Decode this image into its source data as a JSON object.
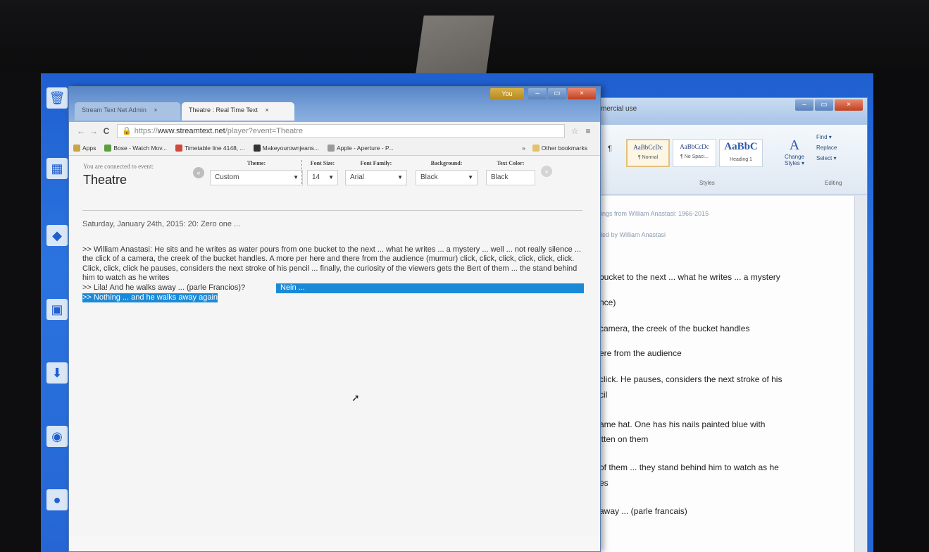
{
  "chrome": {
    "tabs": [
      {
        "label": "Stream Text Net Admin",
        "close": "×"
      },
      {
        "label": "Theatre : Real Time Text",
        "close": "×"
      }
    ],
    "user_button": "You",
    "window_controls": [
      "–",
      "▭",
      "×"
    ],
    "nav": {
      "back": "←",
      "forward": "→",
      "reload": "C"
    },
    "url": {
      "scheme": "https://",
      "host": "www.streamtext.net",
      "path": "/player?event=Theatre"
    },
    "star": "☆",
    "menu": "≡",
    "bookmarks": [
      {
        "label": "Apps",
        "color": "#c9a44b"
      },
      {
        "label": "Bose - Watch Mov...",
        "color": "#5aa03c"
      },
      {
        "label": "Timetable line 4148, ...",
        "color": "#d0483a"
      },
      {
        "label": "Makeyourownjeans...",
        "color": "#333333"
      },
      {
        "label": "Apple - Aperture - P...",
        "color": "#9a9a9a"
      }
    ],
    "bookmarks_overflow": "»",
    "other_bookmarks": "Other bookmarks"
  },
  "player": {
    "connected_label": "You are connected to event:",
    "event_name": "Theatre",
    "theme": {
      "label": "Theme:",
      "value": "Custom"
    },
    "font_size": {
      "label": "Font Size:",
      "value": "14"
    },
    "font_family": {
      "label": "Font Family:",
      "value": "Arial"
    },
    "background": {
      "label": "Background:",
      "value": "Black"
    },
    "text_color": {
      "label": "Text Color:",
      "value": "Black"
    },
    "transcript": {
      "date_line": "Saturday, January 24th, 2015: 20: Zero one ...",
      "paragraph": ">> William Anastasi: He sits and he writes as water pours from one bucket to the next ... what he writes ... a mystery ... well ... not really silence ... the click of a camera, the creek of the bucket handles. A more per here and there from the audience (murmur) click, click, click, click, click, click. Click, click, click he pauses, considers the next stroke of his pencil ... finally, the curiosity of the viewers gets the Bert of them ... the stand behind him to watch as he writes",
      "line_lila": ">> Lila! And he walks away ... (parle Francios)?",
      "line_nein": "Nein ...",
      "line_nothing": ">> Nothing ... and he walks away again"
    }
  },
  "word": {
    "title": "mercial use",
    "window_controls": [
      "–",
      "▭",
      "×"
    ],
    "styles": [
      {
        "sample": "AaBbCcDc",
        "name": "¶ Normal"
      },
      {
        "sample": "AaBbCcDc",
        "name": "¶ No Spaci..."
      },
      {
        "sample": "AaBbC",
        "name": "Heading 1"
      }
    ],
    "change_styles": {
      "big": "A",
      "label": "Change Styles ▾"
    },
    "editing": [
      "Find ▾",
      "Replace",
      "Select ▾"
    ],
    "group_styles": "Styles",
    "group_editing": "Editing",
    "doc_header": "ings from William Anastasi: 1966-2015",
    "doc_subheader": "led by William Anastasi",
    "lines": [
      "bucket to the next ... what he writes ... a mystery",
      "nce)",
      "camera, the creek of the bucket handles",
      "ere from the audience",
      "click. He pauses, considers the next stroke of his",
      "cil",
      "ame hat. One has his nails painted blue with",
      "itten on them",
      "of them ... they stand behind him to watch as he",
      "es",
      "away ... (parle francais)"
    ]
  }
}
